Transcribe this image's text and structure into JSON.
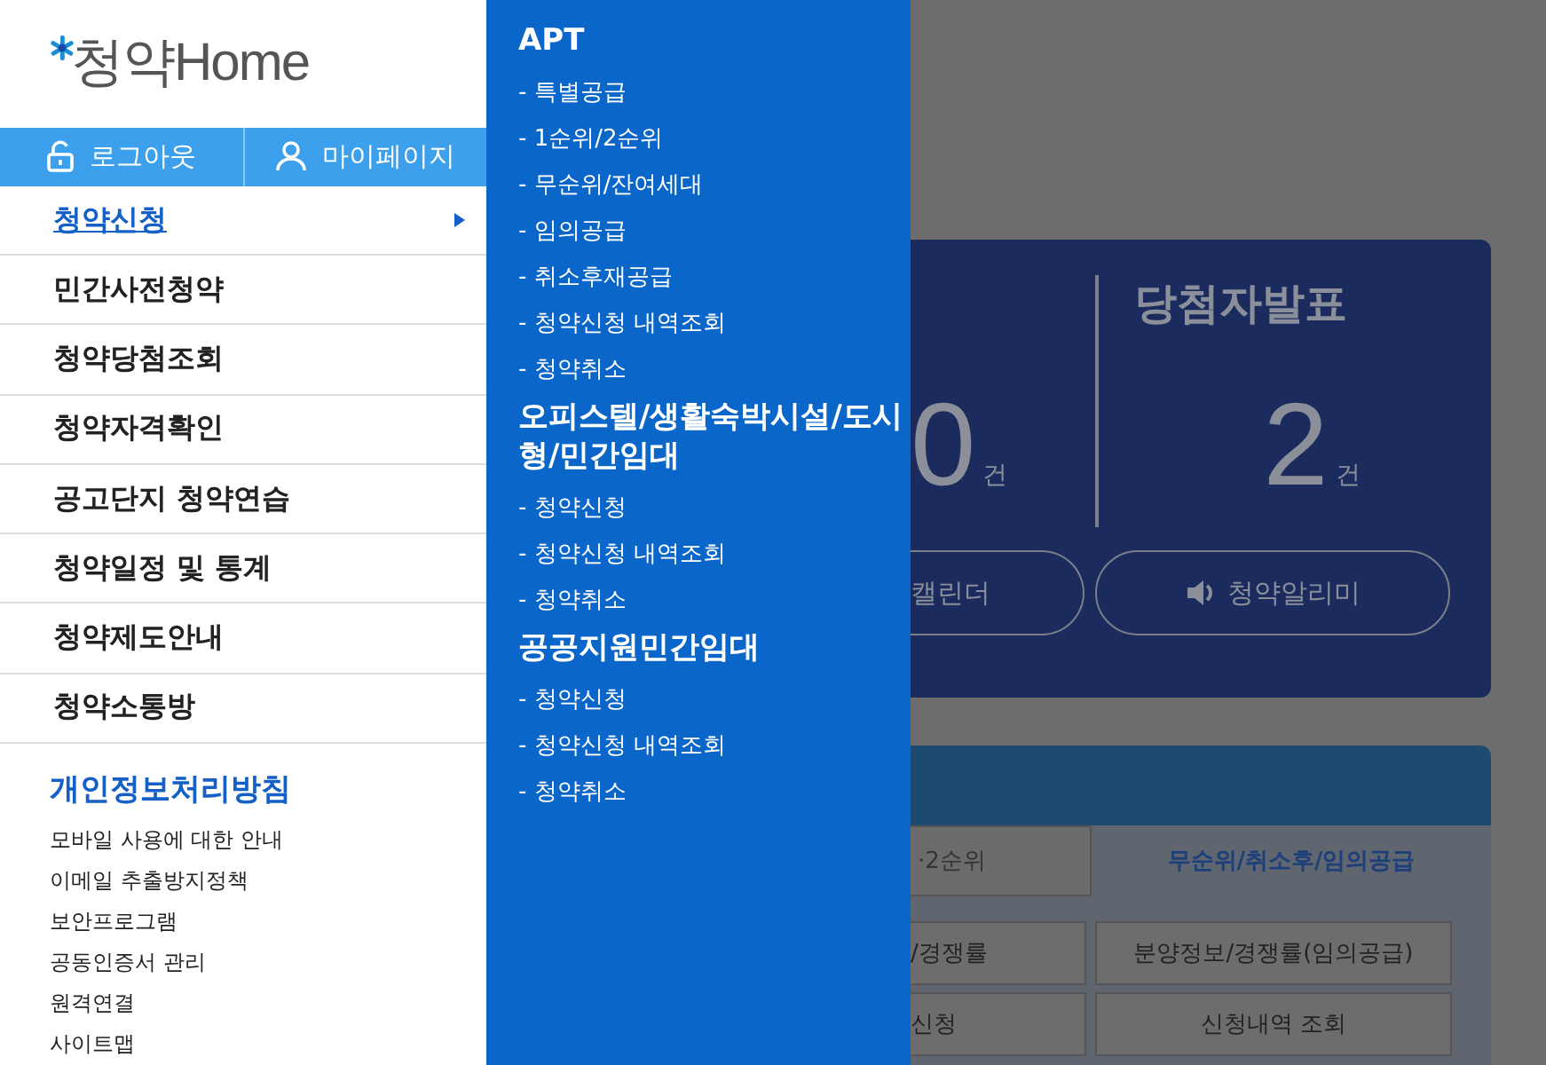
{
  "logo": {
    "text": "청약Home"
  },
  "account_buttons": [
    {
      "label": "로그아웃",
      "kind": "logout"
    },
    {
      "label": "마이페이지",
      "kind": "mypage"
    }
  ],
  "menu": [
    {
      "label": "청약신청",
      "selected": true
    },
    {
      "label": "민간사전청약",
      "selected": false
    },
    {
      "label": "청약당첨조회",
      "selected": false
    },
    {
      "label": "청약자격확인",
      "selected": false
    },
    {
      "label": "공고단지 청약연습",
      "selected": false
    },
    {
      "label": "청약일정 및 통계",
      "selected": false
    },
    {
      "label": "청약제도안내",
      "selected": false
    },
    {
      "label": "청약소통방",
      "selected": false
    }
  ],
  "privacy_link": "개인정보처리방침",
  "footer_links": [
    "모바일 사용에 대한 안내",
    "이메일 추출방지정책",
    "보안프로그램",
    "공동인증서 관리",
    "원격연결",
    "사이트맵"
  ],
  "submenu": [
    {
      "title": "APT",
      "items": [
        "- 특별공급",
        "- 1순위/2순위",
        "- 무순위/잔여세대",
        "- 임의공급",
        "- 취소후재공급",
        "- 청약신청 내역조회",
        "- 청약취소"
      ]
    },
    {
      "title": "오피스텔/생활숙박시설/도시형/민간임대",
      "items": [
        "- 청약신청",
        "- 청약신청 내역조회",
        "- 청약취소"
      ]
    },
    {
      "title": "공공지원민간임대",
      "items": [
        "- 청약신청",
        "- 청약신청 내역조회",
        "- 청약취소"
      ]
    }
  ],
  "background": {
    "stats": [
      {
        "count": "0",
        "unit": "건"
      },
      {
        "title": "당첨자발표",
        "count": "2",
        "unit": "건"
      }
    ],
    "buttons": [
      {
        "label": "캘린더",
        "kind": "plain"
      },
      {
        "label": "청약알리미",
        "kind": "alarm"
      }
    ],
    "tabs": [
      {
        "label": "·2순위",
        "selected": false
      },
      {
        "label": "무순위/취소후/임의공급",
        "selected": true
      }
    ],
    "links": [
      "/경쟁률",
      "분양정보/경쟁률(임의공급)",
      "신청",
      "신청내역 조회"
    ]
  }
}
